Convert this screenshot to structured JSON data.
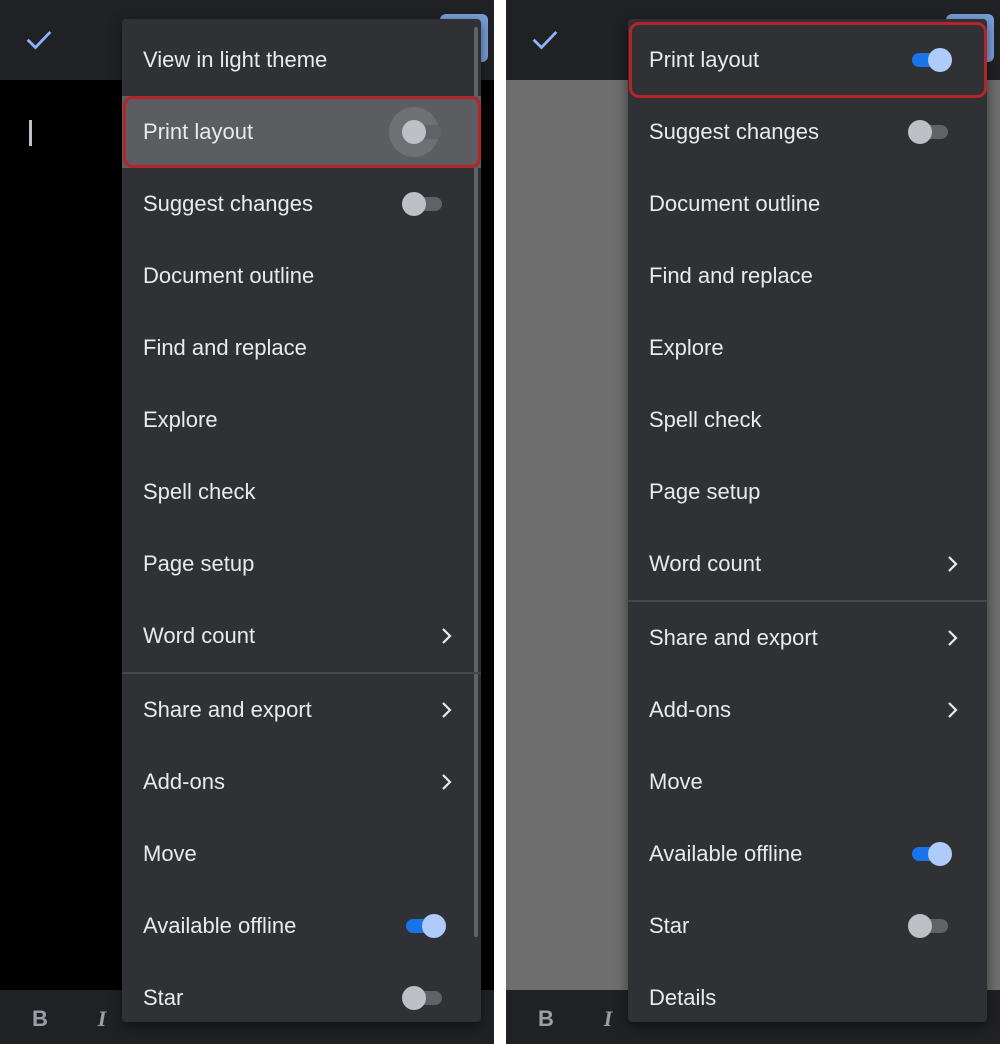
{
  "left_menu": {
    "items": [
      {
        "label": "View in light theme"
      },
      {
        "label": "Print layout",
        "toggle": "off"
      },
      {
        "label": "Suggest changes",
        "toggle": "off"
      },
      {
        "label": "Document outline"
      },
      {
        "label": "Find and replace"
      },
      {
        "label": "Explore"
      },
      {
        "label": "Spell check"
      },
      {
        "label": "Page setup"
      },
      {
        "label": "Word count",
        "submenu": true
      },
      {
        "label": "Share and export",
        "submenu": true
      },
      {
        "label": "Add-ons",
        "submenu": true
      },
      {
        "label": "Move"
      },
      {
        "label": "Available offline",
        "toggle": "on"
      },
      {
        "label": "Star",
        "toggle": "off"
      }
    ]
  },
  "right_menu": {
    "items": [
      {
        "label": "Print layout",
        "toggle": "on"
      },
      {
        "label": "Suggest changes",
        "toggle": "off"
      },
      {
        "label": "Document outline"
      },
      {
        "label": "Find and replace"
      },
      {
        "label": "Explore"
      },
      {
        "label": "Spell check"
      },
      {
        "label": "Page setup"
      },
      {
        "label": "Word count",
        "submenu": true
      },
      {
        "label": "Share and export",
        "submenu": true
      },
      {
        "label": "Add-ons",
        "submenu": true
      },
      {
        "label": "Move"
      },
      {
        "label": "Available offline",
        "toggle": "on"
      },
      {
        "label": "Star",
        "toggle": "off"
      },
      {
        "label": "Details"
      }
    ]
  },
  "toolbar": {
    "bold_label": "B",
    "italic_label": "I"
  },
  "colors": {
    "menu_bg": "#303134",
    "toggle_on": "#1a73e8",
    "highlight": "#b3242b"
  },
  "icons": {
    "check": "check-icon",
    "chevron": "chevron-right-icon"
  }
}
